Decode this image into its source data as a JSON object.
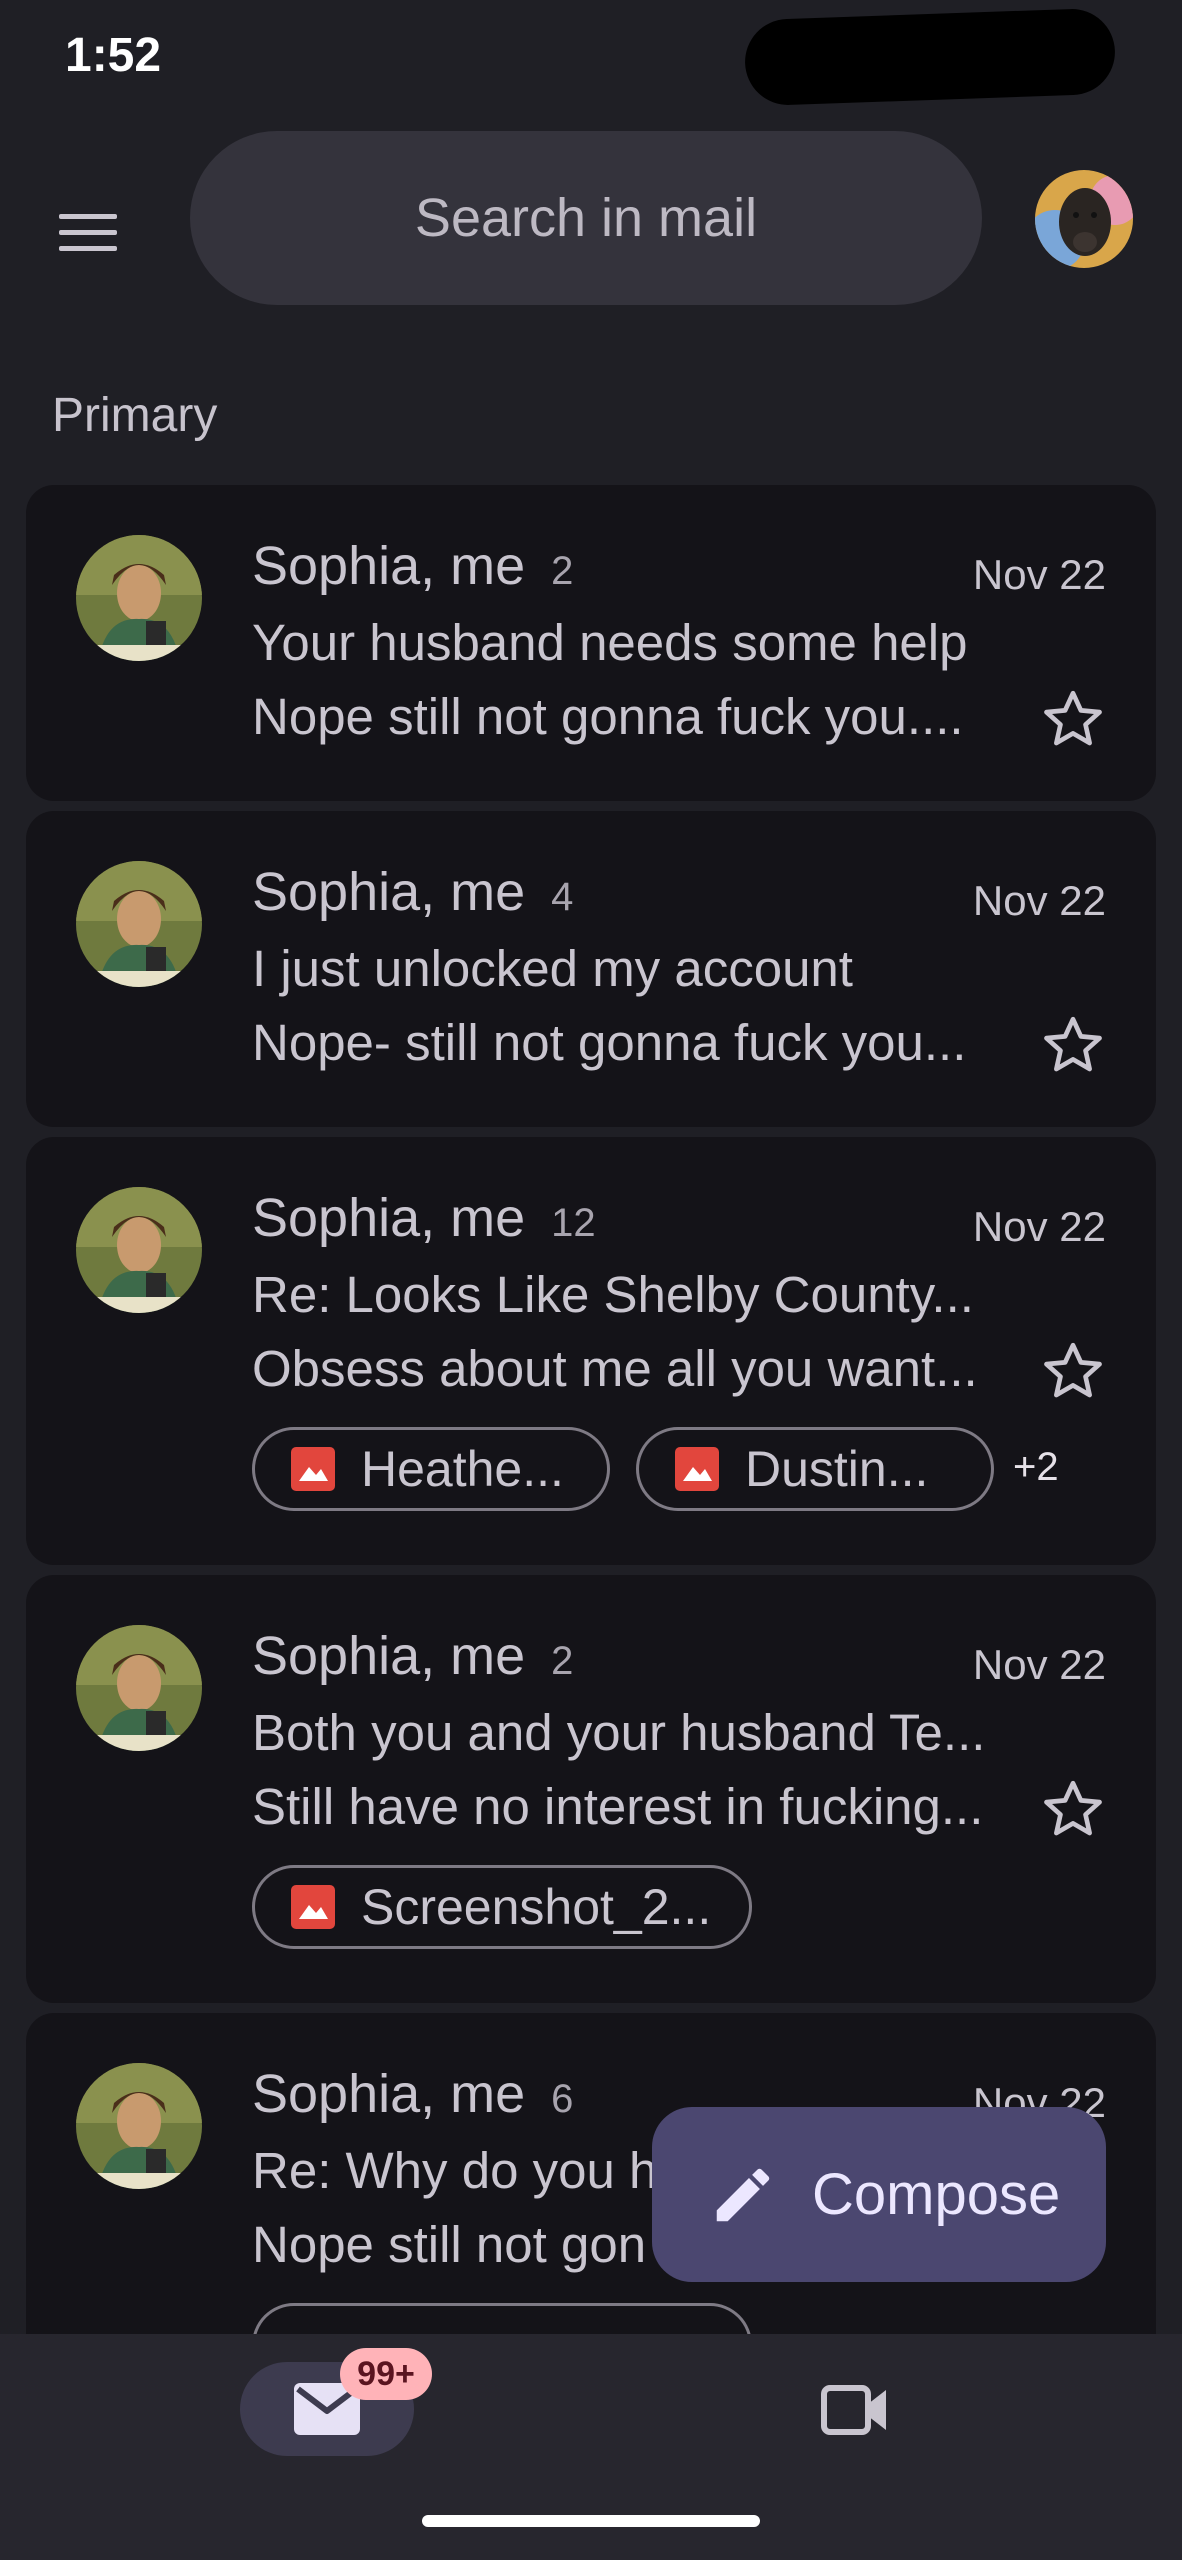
{
  "status": {
    "time": "1:52"
  },
  "search": {
    "placeholder": "Search in mail"
  },
  "section": {
    "label": "Primary"
  },
  "emails": [
    {
      "sender": "Sophia, me",
      "count": "2",
      "date": "Nov 22",
      "subject": "Your husband needs some help",
      "snippet": "Nope still not gonna fuck you...."
    },
    {
      "sender": "Sophia, me",
      "count": "4",
      "date": "Nov 22",
      "subject": "I just unlocked my account",
      "snippet": "Nope- still not gonna fuck you..."
    },
    {
      "sender": "Sophia, me",
      "count": "12",
      "date": "Nov 22",
      "subject": "Re: Looks Like Shelby County...",
      "snippet": "Obsess about me all you want...",
      "attachments": [
        "Heathe...",
        "Dustin..."
      ],
      "more": "+2"
    },
    {
      "sender": "Sophia, me",
      "count": "2",
      "date": "Nov 22",
      "subject": "Both you and your husband Te...",
      "snippet": "Still have no interest in fucking...",
      "attachments": [
        "Screenshot_2..."
      ]
    },
    {
      "sender": "Sophia, me",
      "count": "6",
      "date": "Nov 22",
      "subject": "Re: Why do you h",
      "snippet": "Nope still not gon"
    }
  ],
  "compose": {
    "label": "Compose"
  },
  "nav": {
    "mail_badge": "99+"
  },
  "colors": {
    "background": "#1f1f25",
    "card": "#141318",
    "fab": "#4b4770",
    "badge": "#ffb3b8",
    "attachment_icon": "#e2463d"
  },
  "icons": [
    "menu-icon",
    "star-icon",
    "image-icon",
    "pencil-icon",
    "mail-icon",
    "video-icon"
  ]
}
